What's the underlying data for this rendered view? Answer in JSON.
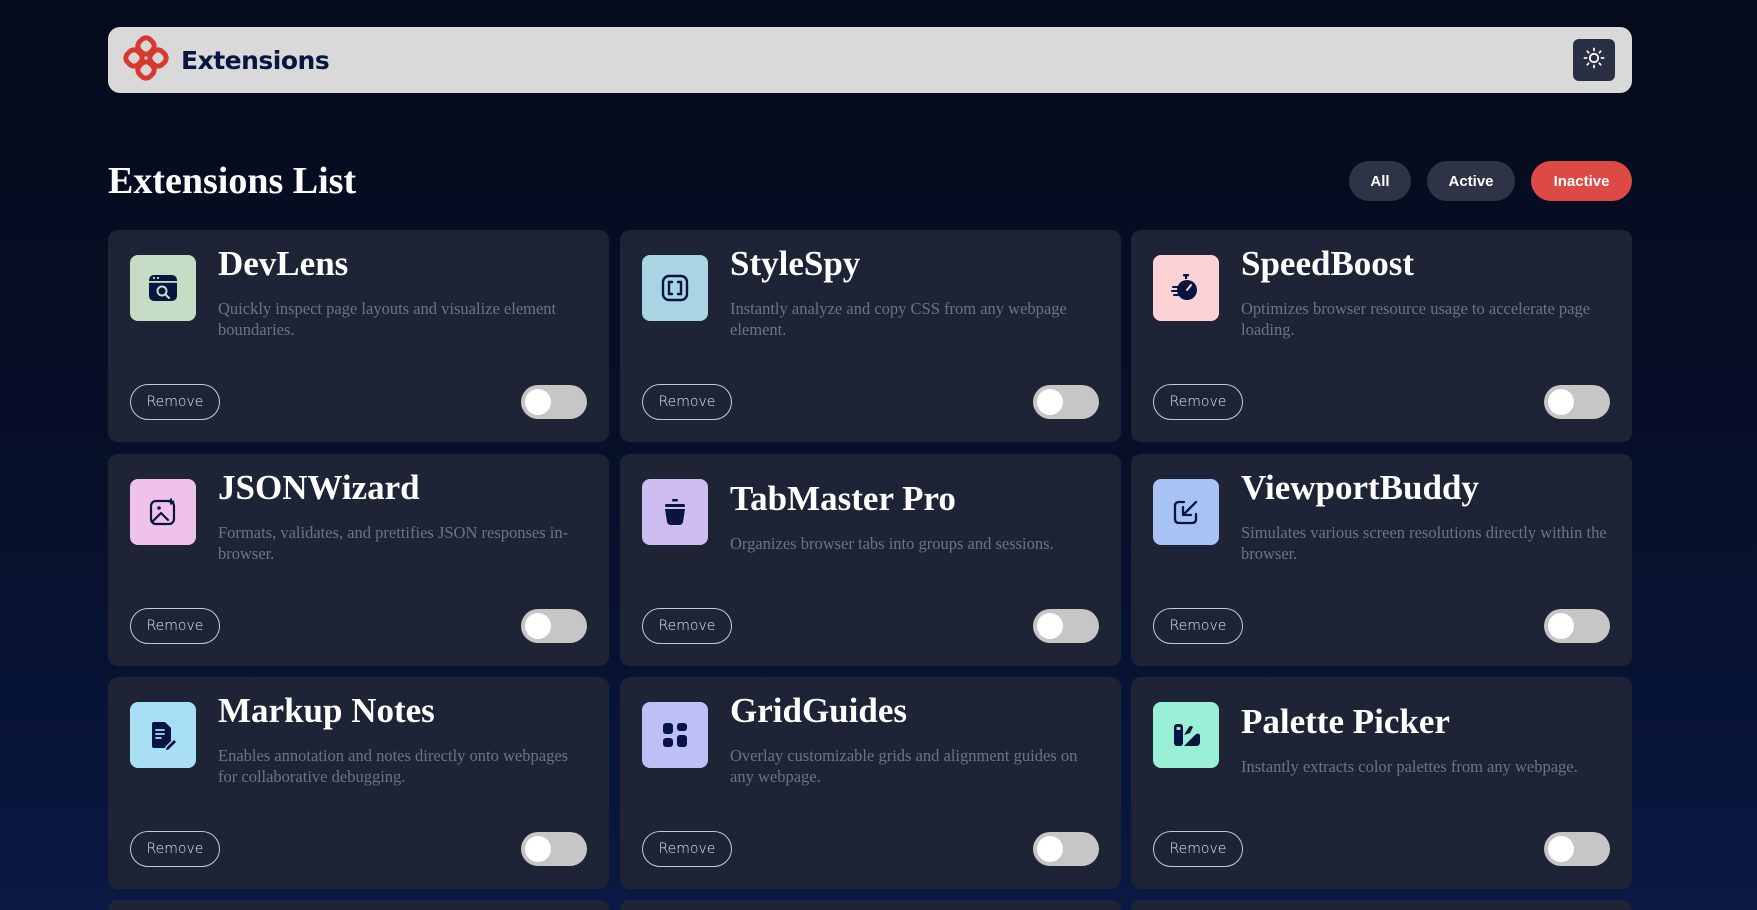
{
  "header": {
    "brand": "Extensions",
    "theme_toggle_icon": "sun-icon",
    "logo_icon": "extensions-logo-icon",
    "logo_color": "#d6392f"
  },
  "main": {
    "title": "Extensions List",
    "filters": [
      {
        "label": "All",
        "selected": false
      },
      {
        "label": "Active",
        "selected": false
      },
      {
        "label": "Inactive",
        "selected": true,
        "color": "#dd4a45"
      }
    ],
    "remove_label": "Remove",
    "extensions": [
      {
        "name": "DevLens",
        "description": "Quickly inspect page layouts and visualize element boundaries.",
        "icon": "inspect-browser-icon",
        "icon_bg": "#c7dcc5",
        "active": false
      },
      {
        "name": "StyleSpy",
        "description": "Instantly analyze and copy CSS from any webpage element.",
        "icon": "brackets-icon",
        "icon_bg": "#a9d4e1",
        "active": false
      },
      {
        "name": "SpeedBoost",
        "description": "Optimizes browser resource usage to accelerate page loading.",
        "icon": "stopwatch-icon",
        "icon_bg": "#fbd3d7",
        "active": false
      },
      {
        "name": "JSONWizard",
        "description": "Formats, validates, and prettifies JSON responses in-browser.",
        "icon": "image-sparkle-icon",
        "icon_bg": "#efc2ea",
        "active": false
      },
      {
        "name": "TabMaster Pro",
        "description": "Organizes browser tabs into groups and sessions.",
        "icon": "pot-icon",
        "icon_bg": "#cdbdf0",
        "active": false
      },
      {
        "name": "ViewportBuddy",
        "description": "Simulates various screen resolutions directly within the browser.",
        "icon": "resize-arrow-icon",
        "icon_bg": "#a7c3f6",
        "active": false
      },
      {
        "name": "Markup Notes",
        "description": "Enables annotation and notes directly onto webpages for collaborative debugging.",
        "icon": "note-pen-icon",
        "icon_bg": "#a9dff5",
        "active": false
      },
      {
        "name": "GridGuides",
        "description": "Overlay customizable grids and alignment guides on any webpage.",
        "icon": "grid-blocks-icon",
        "icon_bg": "#bfbff8",
        "active": false
      },
      {
        "name": "Palette Picker",
        "description": "Instantly extracts color palettes from any webpage.",
        "icon": "palette-icon",
        "icon_bg": "#9af0d7",
        "active": false
      }
    ]
  }
}
